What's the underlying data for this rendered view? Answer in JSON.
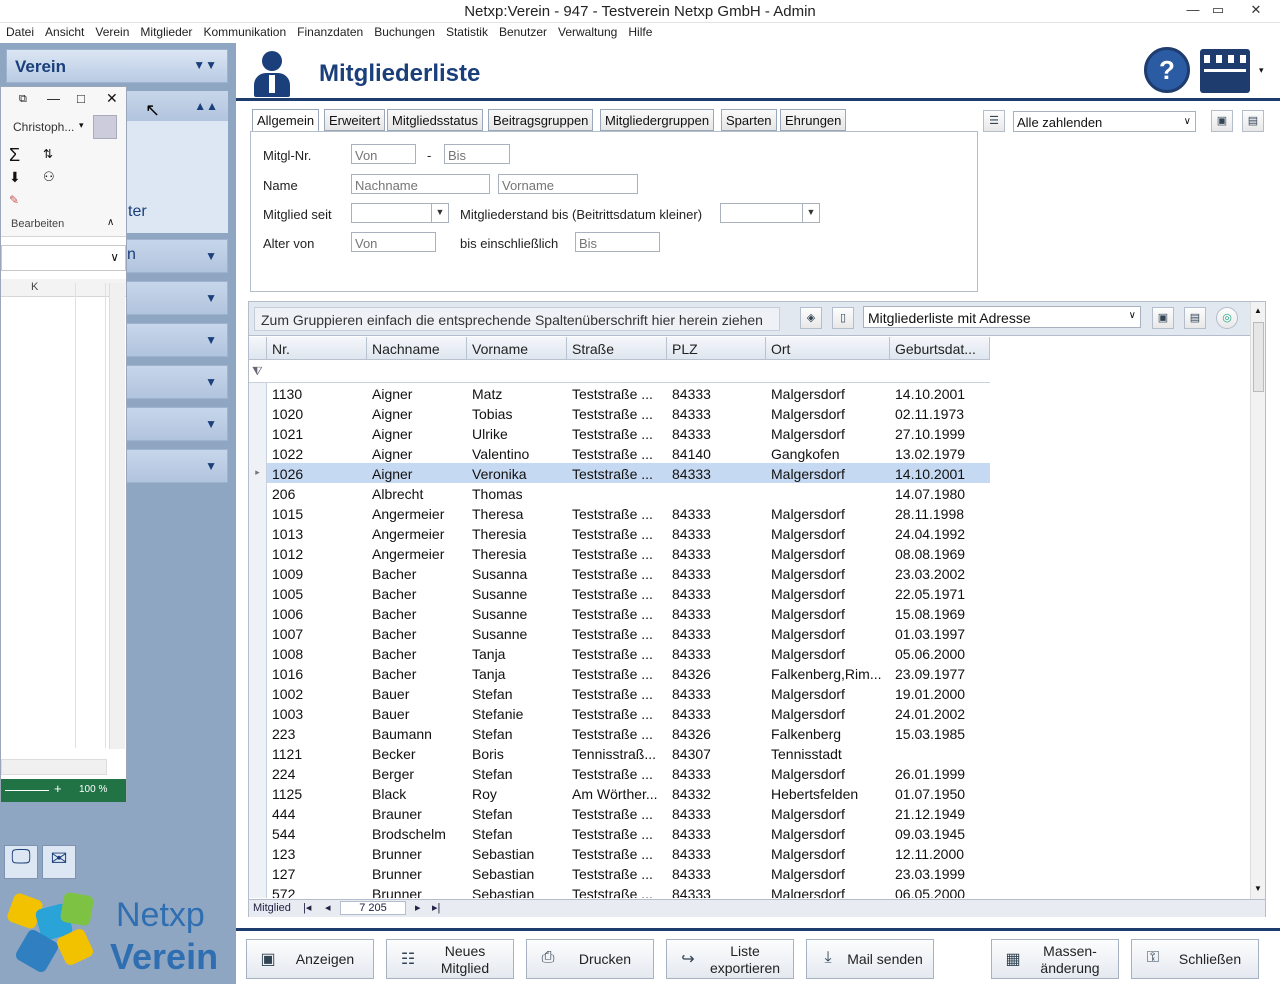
{
  "window": {
    "title": "Netxp:Verein - 947 - Testverein Netxp GmbH - Admin",
    "minimize": "—",
    "restore": "▭",
    "close": "✕"
  },
  "menu": [
    "Datei",
    "Ansicht",
    "Verein",
    "Mitglieder",
    "Kommunikation",
    "Finanzdaten",
    "Buchungen",
    "Statistik",
    "Benutzer",
    "Verwaltung",
    "Hilfe"
  ],
  "sidebar": {
    "header": "Verein",
    "panel_text": "ter",
    "combo_text": "n"
  },
  "floatwin": {
    "user": "Christoph...",
    "group_label": "Bearbeiten",
    "col_label": "K",
    "zoom": "100 %"
  },
  "header": {
    "title": "Mitgliederliste"
  },
  "tabs": [
    "Allgemein",
    "Erweitert",
    "Mitgliedsstatus",
    "Beitragsgruppen",
    "Mitgliedergruppen",
    "Sparten",
    "Ehrungen"
  ],
  "filters": {
    "mitglnr_label": "Mitgl-Nr.",
    "von_placeholder": "Von",
    "dash": "-",
    "bis_placeholder": "Bis",
    "name_label": "Name",
    "nachname_placeholder": "Nachname",
    "vorname_placeholder": "Vorname",
    "mitglied_seit_label": "Mitglied seit",
    "mitgliederstand_label": "Mitgliederstand bis (Beitrittsdatum kleiner)",
    "alter_label": "Alter von",
    "alter_von_placeholder": "Von",
    "bis_einschl_label": "bis einschließlich",
    "alter_bis_placeholder": "Bis",
    "payer_select": "Alle zahlenden"
  },
  "grid": {
    "group_hint": "Zum Gruppieren einfach die entsprechende Spaltenüberschrift hier herein ziehen",
    "layout_select": "Mitgliederliste mit Adresse",
    "columns": [
      "Nr.",
      "Nachname",
      "Vorname",
      "Straße",
      "PLZ",
      "Ort",
      "Geburtsdat..."
    ],
    "rows": [
      [
        "1130",
        "Aigner",
        "Matz",
        "Teststraße ...",
        "84333",
        "Malgersdorf",
        "14.10.2001"
      ],
      [
        "1020",
        "Aigner",
        "Tobias",
        "Teststraße ...",
        "84333",
        "Malgersdorf",
        "02.11.1973"
      ],
      [
        "1021",
        "Aigner",
        "Ulrike",
        "Teststraße ...",
        "84333",
        "Malgersdorf",
        "27.10.1999"
      ],
      [
        "1022",
        "Aigner",
        "Valentino",
        "Teststraße ...",
        "84140",
        "Gangkofen",
        "13.02.1979"
      ],
      [
        "1026",
        "Aigner",
        "Veronika",
        "Teststraße ...",
        "84333",
        "Malgersdorf",
        "14.10.2001"
      ],
      [
        "206",
        "Albrecht",
        "Thomas",
        "",
        "",
        "",
        "14.07.1980"
      ],
      [
        "1015",
        "Angermeier",
        "Theresa",
        "Teststraße ...",
        "84333",
        "Malgersdorf",
        "28.11.1998"
      ],
      [
        "1013",
        "Angermeier",
        "Theresia",
        "Teststraße ...",
        "84333",
        "Malgersdorf",
        "24.04.1992"
      ],
      [
        "1012",
        "Angermeier",
        "Theresia",
        "Teststraße ...",
        "84333",
        "Malgersdorf",
        "08.08.1969"
      ],
      [
        "1009",
        "Bacher",
        "Susanna",
        "Teststraße ...",
        "84333",
        "Malgersdorf",
        "23.03.2002"
      ],
      [
        "1005",
        "Bacher",
        "Susanne",
        "Teststraße ...",
        "84333",
        "Malgersdorf",
        "22.05.1971"
      ],
      [
        "1006",
        "Bacher",
        "Susanne",
        "Teststraße ...",
        "84333",
        "Malgersdorf",
        "15.08.1969"
      ],
      [
        "1007",
        "Bacher",
        "Susanne",
        "Teststraße ...",
        "84333",
        "Malgersdorf",
        "01.03.1997"
      ],
      [
        "1008",
        "Bacher",
        "Tanja",
        "Teststraße ...",
        "84333",
        "Malgersdorf",
        "05.06.2000"
      ],
      [
        "1016",
        "Bacher",
        "Tanja",
        "Teststraße ...",
        "84326",
        "Falkenberg,Rim...",
        "23.09.1977"
      ],
      [
        "1002",
        "Bauer",
        "Stefan",
        "Teststraße ...",
        "84333",
        "Malgersdorf",
        "19.01.2000"
      ],
      [
        "1003",
        "Bauer",
        "Stefanie",
        "Teststraße ...",
        "84333",
        "Malgersdorf",
        "24.01.2002"
      ],
      [
        "223",
        "Baumann",
        "Stefan",
        "Teststraße ...",
        "84326",
        "Falkenberg",
        "15.03.1985"
      ],
      [
        "1121",
        "Becker",
        "Boris",
        "Tennisstraß...",
        "84307",
        "Tennisstadt",
        ""
      ],
      [
        "224",
        "Berger",
        "Stefan",
        "Teststraße ...",
        "84333",
        "Malgersdorf",
        "26.01.1999"
      ],
      [
        "1125",
        "Black",
        "Roy",
        "Am Wörther...",
        "84332",
        "Hebertsfelden",
        "01.07.1950"
      ],
      [
        "444",
        "Brauner",
        "Stefan",
        "Teststraße ...",
        "84333",
        "Malgersdorf",
        "21.12.1949"
      ],
      [
        "544",
        "Brodschelm",
        "Stefan",
        "Teststraße ...",
        "84333",
        "Malgersdorf",
        "09.03.1945"
      ],
      [
        "123",
        "Brunner",
        "Sebastian",
        "Teststraße ...",
        "84333",
        "Malgersdorf",
        "12.11.2000"
      ],
      [
        "127",
        "Brunner",
        "Sebastian",
        "Teststraße ...",
        "84333",
        "Malgersdorf",
        "23.03.1999"
      ],
      [
        "572",
        "Brunner",
        "Sebastian",
        "Teststraße ...",
        "84333",
        "Malgersdorf",
        "06.05.2000"
      ]
    ],
    "selected_row": 4,
    "nav": {
      "label": "Mitglied",
      "position": "7 205"
    }
  },
  "buttons": {
    "anzeigen": "Anzeigen",
    "neues_mitglied": [
      "Neues",
      "Mitglied"
    ],
    "drucken": "Drucken",
    "liste_exportieren": [
      "Liste",
      "exportieren"
    ],
    "mail_senden": "Mail senden",
    "massenaenderung": [
      "Massen-",
      "änderung"
    ],
    "schliessen": "Schließen"
  },
  "logo": {
    "line1": "Netxp",
    "line2": "Verein"
  },
  "colors": {
    "brand_blue": "#1a3f7a",
    "sidebar": "#8fa6c3",
    "selected_row": "#c6d9f2",
    "excel_green": "#217346"
  }
}
